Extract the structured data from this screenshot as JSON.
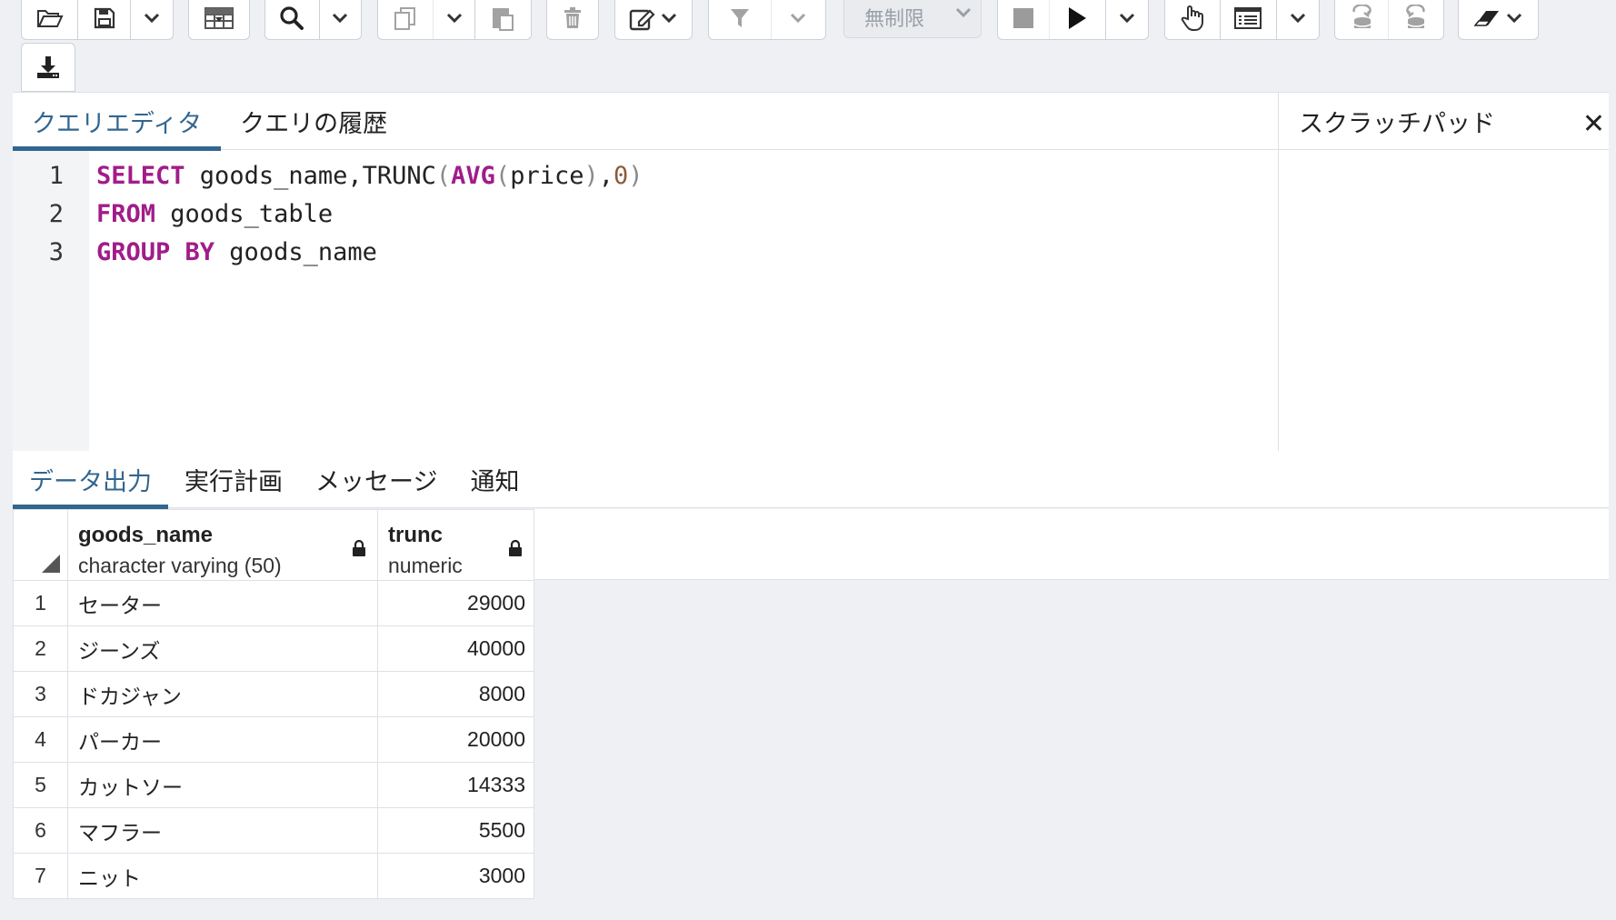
{
  "toolbar": {
    "limit_label": "無制限"
  },
  "editor": {
    "tabs": [
      "クエリエディタ",
      "クエリの履歴"
    ],
    "line_numbers": [
      "1",
      "2",
      "3"
    ],
    "code": {
      "l1_select": "SELECT",
      "l1_cols": " goods_name,TRUNC",
      "l1_open": "(",
      "l1_avg": "AVG",
      "l1_open2": "(",
      "l1_price": "price",
      "l1_close": ")",
      "l1_comma": ",",
      "l1_zero": "0",
      "l1_close2": ")",
      "l2_from": "FROM",
      "l2_table": " goods_table",
      "l3_group": "GROUP BY",
      "l3_col": " goods_name"
    }
  },
  "scratchpad": {
    "title": "スクラッチパッド",
    "close": "✕"
  },
  "output": {
    "tabs": [
      "データ出力",
      "実行計画",
      "メッセージ",
      "通知"
    ],
    "columns": [
      {
        "name": "goods_name",
        "type": "character varying (50)"
      },
      {
        "name": "trunc",
        "type": "numeric"
      }
    ],
    "rows": [
      {
        "n": "1",
        "name": "セーター",
        "value": "29000"
      },
      {
        "n": "2",
        "name": "ジーンズ",
        "value": "40000"
      },
      {
        "n": "3",
        "name": "ドカジャン",
        "value": "8000"
      },
      {
        "n": "4",
        "name": "パーカー",
        "value": "20000"
      },
      {
        "n": "5",
        "name": "カットソー",
        "value": "14333"
      },
      {
        "n": "6",
        "name": "マフラー",
        "value": "5500"
      },
      {
        "n": "7",
        "name": "ニット",
        "value": "3000"
      }
    ]
  },
  "colors": {
    "accent": "#326690",
    "keyword": "#a11c8a",
    "background": "#eef0f4"
  }
}
